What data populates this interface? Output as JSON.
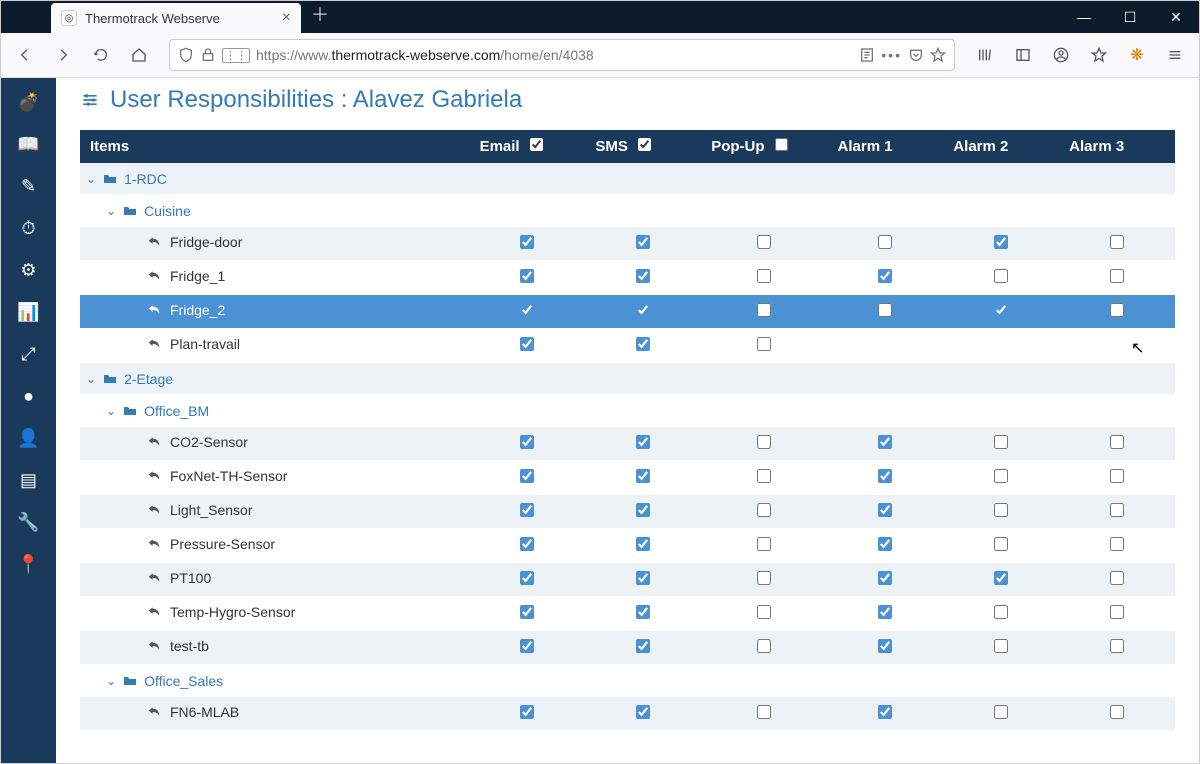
{
  "browser": {
    "tab_title": "Thermotrack Webserve",
    "url_display_prefix": "https://www.",
    "url_display_host": "thermotrack-webserve.com",
    "url_display_path": "/home/en/4038"
  },
  "page": {
    "title": "User Responsibilities : Alavez Gabriela"
  },
  "headers": {
    "items": "Items",
    "email": "Email",
    "sms": "SMS",
    "popup": "Pop-Up",
    "alarm1": "Alarm 1",
    "alarm2": "Alarm 2",
    "alarm3": "Alarm 3",
    "email_checked": true,
    "sms_checked": true,
    "popup_checked": false
  },
  "rows": [
    {
      "type": "folder",
      "level": 0,
      "label": "1-RDC"
    },
    {
      "type": "folder",
      "level": 1,
      "label": "Cuisine"
    },
    {
      "type": "leaf",
      "level": 2,
      "label": "Fridge-door",
      "email": true,
      "sms": true,
      "popup": false,
      "a1": false,
      "a2": true,
      "a3": false
    },
    {
      "type": "leaf",
      "level": 2,
      "label": "Fridge_1",
      "email": true,
      "sms": true,
      "popup": false,
      "a1": true,
      "a2": false,
      "a3": false
    },
    {
      "type": "leaf",
      "level": 2,
      "label": "Fridge_2",
      "selected": true,
      "email": true,
      "sms": true,
      "popup": false,
      "a1": false,
      "a2": true,
      "a3": false
    },
    {
      "type": "leaf",
      "level": 2,
      "label": "Plan-travail",
      "email": true,
      "sms": true,
      "popup": false,
      "a1": null,
      "a2": null,
      "a3": null
    },
    {
      "type": "folder",
      "level": 0,
      "label": "2-Etage"
    },
    {
      "type": "folder",
      "level": 1,
      "label": "Office_BM"
    },
    {
      "type": "leaf",
      "level": 2,
      "label": "CO2-Sensor",
      "email": true,
      "sms": true,
      "popup": false,
      "a1": true,
      "a2": false,
      "a3": false
    },
    {
      "type": "leaf",
      "level": 2,
      "label": "FoxNet-TH-Sensor",
      "email": true,
      "sms": true,
      "popup": false,
      "a1": true,
      "a2": false,
      "a3": false
    },
    {
      "type": "leaf",
      "level": 2,
      "label": "Light_Sensor",
      "email": true,
      "sms": true,
      "popup": false,
      "a1": true,
      "a2": false,
      "a3": false
    },
    {
      "type": "leaf",
      "level": 2,
      "label": "Pressure-Sensor",
      "email": true,
      "sms": true,
      "popup": false,
      "a1": true,
      "a2": false,
      "a3": false
    },
    {
      "type": "leaf",
      "level": 2,
      "label": "PT100",
      "email": true,
      "sms": true,
      "popup": false,
      "a1": true,
      "a2": true,
      "a3": false
    },
    {
      "type": "leaf",
      "level": 2,
      "label": "Temp-Hygro-Sensor",
      "email": true,
      "sms": true,
      "popup": false,
      "a1": true,
      "a2": false,
      "a3": false
    },
    {
      "type": "leaf",
      "level": 2,
      "label": "test-tb",
      "email": true,
      "sms": true,
      "popup": false,
      "a1": true,
      "a2": false,
      "a3": false
    },
    {
      "type": "folder",
      "level": 1,
      "label": "Office_Sales"
    },
    {
      "type": "leaf",
      "level": 2,
      "label": "FN6-MLAB",
      "email": true,
      "sms": true,
      "popup": false,
      "a1": true,
      "a2": false,
      "a3": false
    }
  ],
  "sidebar_icons": [
    "bomb-icon",
    "book-icon",
    "edit-icon",
    "gauge-icon",
    "gears-icon",
    "chart-icon",
    "expand-icon",
    "circle-icon",
    "user-icon",
    "newspaper-icon",
    "wrench-icon",
    "pin-icon"
  ]
}
